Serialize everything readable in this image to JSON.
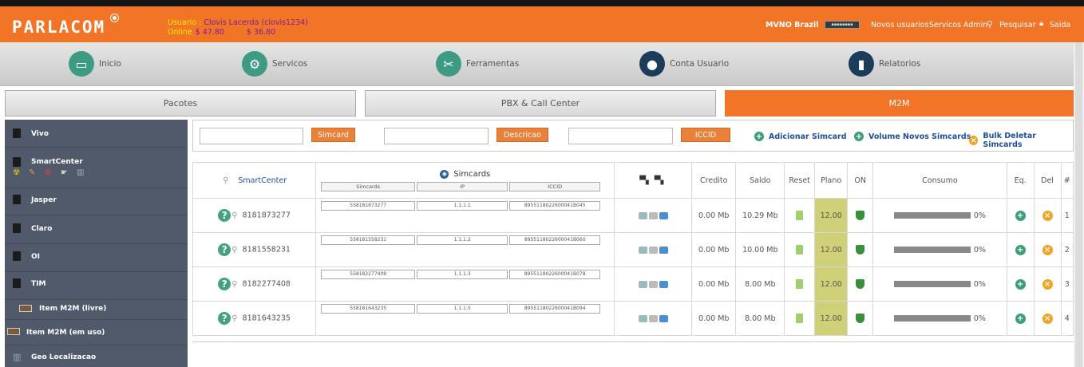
{
  "header": {
    "logo": "PARLACOM",
    "user_label": "Usuario : ",
    "user_name": "Clovis Lacerda (clovis1234)",
    "online_label": "Online",
    "balance1": "$ 47.80",
    "balance2": "$ 36.80",
    "mvno": "MVNO Brazil",
    "links": [
      "Novos usuarios",
      "Servicos Admin",
      "Pesquisar",
      "Saida"
    ],
    "colors": {
      "accent": "#f27426",
      "link": "#1f4e9c"
    }
  },
  "nav": [
    {
      "label": "Inicio",
      "icon": "monitor-icon"
    },
    {
      "label": "Servicos",
      "icon": "gear-icon"
    },
    {
      "label": "Ferramentas",
      "icon": "tools-icon"
    },
    {
      "label": "Conta Usuario",
      "icon": "user-icon"
    },
    {
      "label": "Relatorios",
      "icon": "chart-icon"
    }
  ],
  "tabs": [
    {
      "label": "Pacotes",
      "active": false
    },
    {
      "label": "PBX & Call Center",
      "active": false
    },
    {
      "label": "M2M",
      "active": true
    }
  ],
  "sidebar": [
    "Vivo",
    "SmartCenter",
    "Jasper",
    "Claro",
    "OI",
    "TIM",
    "Item M2M (livre)",
    "Item M2M (em uso)",
    "Geo Localizacao"
  ],
  "filters": {
    "simcard_button": "Simcard",
    "descricao_button": "Descricao",
    "iccid_button": "ICCID",
    "add_simcard": "Adicionar Simcard",
    "volume": "Volume Novos Simcards",
    "bulk_delete": "Bulk Deletar Simcards"
  },
  "table": {
    "headers": {
      "smartcenter": "SmartCenter",
      "simcards": "Simcards",
      "sub_simcards": "Simcards",
      "sub_ip": "IP",
      "sub_iccid": "ICCID",
      "credito": "Credito",
      "saldo": "Saldo",
      "reset": "Reset",
      "plano": "Plano",
      "on": "ON",
      "consumo": "Consumo",
      "eq": "Eq.",
      "del": "Del",
      "num": "#"
    },
    "rows": [
      {
        "smartcenter": "8181873277",
        "simcard": "558181873277",
        "ip": "1.1.1.1",
        "iccid": "8955118022600041B045",
        "credito": "0.00 Mb",
        "saldo": "10.29 Mb",
        "plano": "12.00",
        "consumo": "0%",
        "num": "1"
      },
      {
        "smartcenter": "8181558231",
        "simcard": "558181558231",
        "ip": "1.1.1.2",
        "iccid": "8955118022600041B060",
        "credito": "0.00 Mb",
        "saldo": "10.00 Mb",
        "plano": "12.00",
        "consumo": "0%",
        "num": "2"
      },
      {
        "smartcenter": "8182277408",
        "simcard": "558182277408",
        "ip": "1.1.1.3",
        "iccid": "8955118022600041B078",
        "credito": "0.00 Mb",
        "saldo": "8.00 Mb",
        "plano": "12.00",
        "consumo": "0%",
        "num": "3"
      },
      {
        "smartcenter": "8181643235",
        "simcard": "558181643235",
        "ip": "1.1.1.5",
        "iccid": "8955118022600041B094",
        "credito": "0.00 Mb",
        "saldo": "8.00 Mb",
        "plano": "12.00",
        "consumo": "0%",
        "num": "4"
      }
    ]
  }
}
